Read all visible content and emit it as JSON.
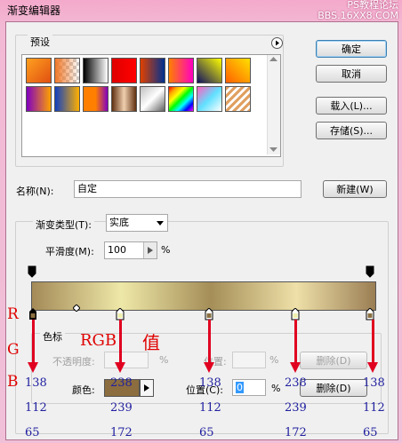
{
  "window": {
    "title": "渐变编辑器",
    "watermark_line1": "PS教程论坛",
    "watermark_line2": "BBS.16XX8.COM"
  },
  "presets": {
    "label": "预设",
    "menu_icon": "arrow-right-icon"
  },
  "buttons": {
    "ok": "确定",
    "cancel": "取消",
    "load": "载入(L)...",
    "save": "存储(S)...",
    "new": "新建(W)"
  },
  "name": {
    "label": "名称(N):",
    "value": "自定"
  },
  "gradient": {
    "type_label": "渐变类型(T):",
    "type_value": "实底",
    "smooth_label": "平滑度(M):",
    "smooth_value": "100",
    "smooth_unit": "%",
    "colors": [
      "#a48a57",
      "#eee8a8",
      "#a58e58",
      "#eee0a8",
      "#9b7e54"
    ]
  },
  "stops": {
    "group_label": "色标",
    "opacity_label": "不透明度:",
    "opacity_unit": "%",
    "position_label_top": "位置:",
    "position_unit_top": "%",
    "delete_top": "删除(D)",
    "color_label": "颜色:",
    "swatch_color": "#8b6d3f",
    "position_label": "位置(C):",
    "position_value": "0",
    "position_unit": "%",
    "delete": "删除(D)"
  },
  "annotations": {
    "r": "R",
    "g": "G",
    "b": "B",
    "rgb": "RGB",
    "value": "值",
    "columns": [
      {
        "r": "138",
        "g": "112",
        "b": "65"
      },
      {
        "r": "238",
        "g": "239",
        "b": "172"
      },
      {
        "r": "138",
        "g": "112",
        "b": "65"
      },
      {
        "r": "238",
        "g": "239",
        "b": "172"
      },
      {
        "r": "138",
        "g": "112",
        "b": "65"
      }
    ]
  }
}
